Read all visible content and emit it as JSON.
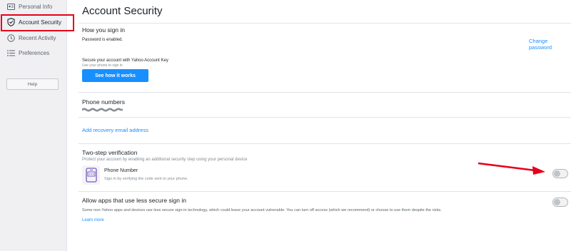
{
  "sidebar": {
    "items": [
      {
        "label": "Personal Info",
        "icon": "id-card-icon"
      },
      {
        "label": "Account Security",
        "icon": "shield-icon",
        "active": true
      },
      {
        "label": "Recent Activity",
        "icon": "clock-icon"
      },
      {
        "label": "Preferences",
        "icon": "list-icon"
      }
    ],
    "help_label": "Help"
  },
  "main": {
    "title": "Account Security",
    "signin": {
      "title": "How you sign in",
      "password_status": "Password is enabled.",
      "change_password_label": "Change password",
      "account_key_title": "Secure your account with Yahoo Account Key",
      "account_key_subtitle": "Use your phone to sign in",
      "see_how_label": "See how it works"
    },
    "phone": {
      "title": "Phone numbers"
    },
    "recovery": {
      "add_email_label": "Add recovery email address"
    },
    "two_step": {
      "title": "Two-step verification",
      "description": "Protect your account by enabling an additional security step using your personal device",
      "method_title": "Phone Number",
      "method_description": "Sign in by verifying the code sent to your phone.",
      "enabled": false
    },
    "less_secure": {
      "title": "Allow apps that use less secure sign in",
      "description": "Some non-Yahoo apps and devices use less secure sign-in technology, which could leave your account vulnerable. You can turn off access (which we recommend) or choose to use them despite the risks.",
      "learn_more_label": "Learn more",
      "enabled": false
    }
  },
  "colors": {
    "accent": "#188fff",
    "highlight_box": "#e60019",
    "arrow": "#e60019",
    "sidebar_bg": "#f0f0f3"
  }
}
